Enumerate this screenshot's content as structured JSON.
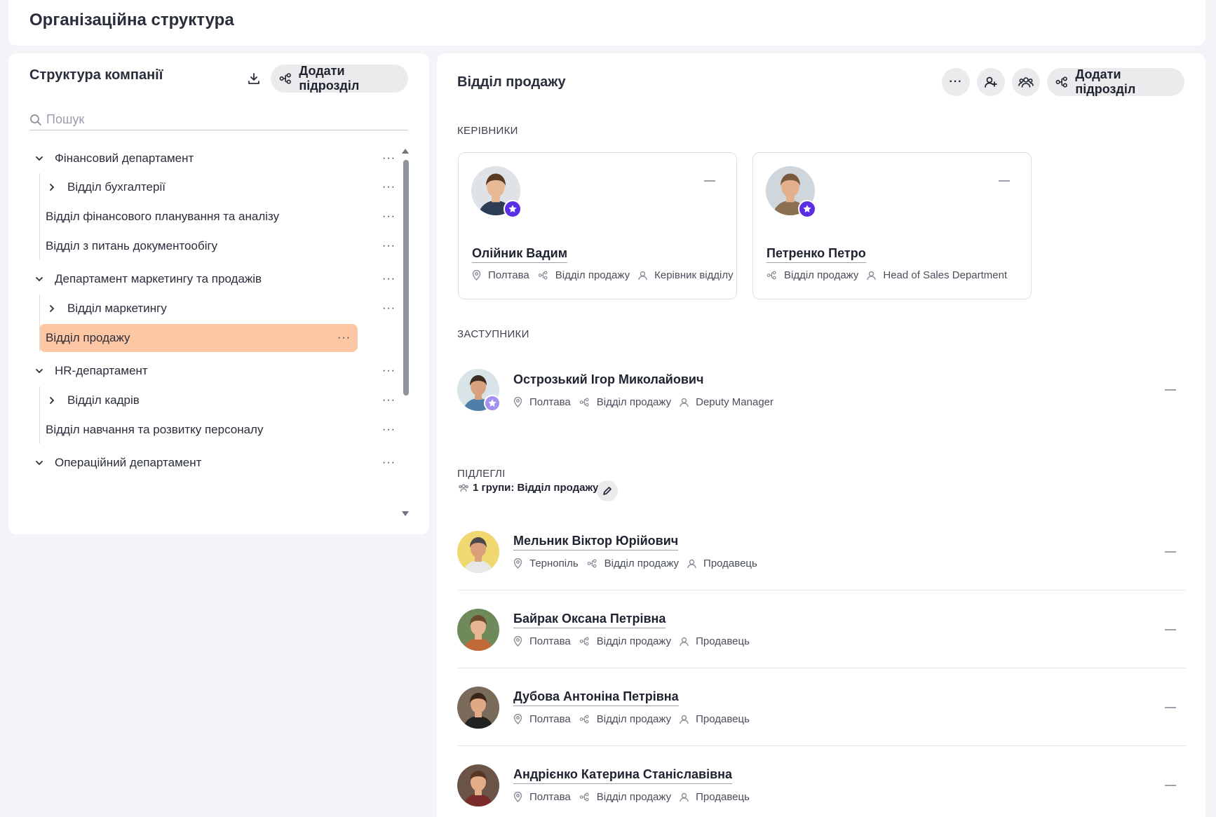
{
  "page": {
    "title": "Організаційна структура"
  },
  "colors": {
    "accent": "#5b2ee6",
    "selected": "#fec7a3",
    "pill": "#ebebee"
  },
  "left": {
    "title": "Структура компанії",
    "download_icon": "download-icon",
    "add_button": "Додати підрозділ",
    "search_placeholder": "Пошук",
    "tree": [
      {
        "label": "Фінансовий департамент",
        "level": 0,
        "chevron": "down"
      },
      {
        "label": "Відділ бухгалтерії",
        "level": 1,
        "chevron": "right"
      },
      {
        "label": "Відділ фінансового планування та аналізу",
        "level": 1,
        "chevron": "none"
      },
      {
        "label": "Відділ з питань документообігу",
        "level": 1,
        "chevron": "none"
      },
      {
        "label": "Департамент маркетингу та продажів",
        "level": 0,
        "chevron": "down"
      },
      {
        "label": "Відділ маркетингу",
        "level": 1,
        "chevron": "right"
      },
      {
        "label": "Відділ продажу",
        "level": 1,
        "chevron": "none",
        "selected": true
      },
      {
        "label": "HR-департамент",
        "level": 0,
        "chevron": "down"
      },
      {
        "label": "Відділ кадрів",
        "level": 1,
        "chevron": "right"
      },
      {
        "label": "Відділ навчання та розвитку персоналу",
        "level": 1,
        "chevron": "none"
      },
      {
        "label": "Операційний департамент",
        "level": 0,
        "chevron": "down"
      }
    ],
    "more": "···"
  },
  "right": {
    "title": "Відділ продажу",
    "more": "···",
    "add_button": "Додати підрозділ",
    "managers_label": "КЕРІВНИКИ",
    "managers": [
      {
        "name": "Олійник Вадим",
        "city": "Полтава",
        "dept": "Відділ продажу",
        "role": "Керівник відділу"
      },
      {
        "name": "Петренко Петро",
        "city": "",
        "dept": "Відділ продажу",
        "role": "Head of Sales Department"
      }
    ],
    "deputies_label": "ЗАСТУПНИКИ",
    "deputies": [
      {
        "name": "Острозький Ігор Миколайович",
        "city": "Полтава",
        "dept": "Відділ продажу",
        "role": "Deputy Manager"
      }
    ],
    "subordinates_label": "ПІДЛЕГЛІ",
    "groups_text": "1 групи: Відділ продажу",
    "subordinates": [
      {
        "name": "Мельник Віктор Юрійович",
        "city": "Тернопіль",
        "dept": "Відділ продажу",
        "role": "Продавець"
      },
      {
        "name": "Байрак Оксана Петрівна",
        "city": "Полтава",
        "dept": "Відділ продажу",
        "role": "Продавець"
      },
      {
        "name": "Дубова Антоніна Петрівна",
        "city": "Полтава",
        "dept": "Відділ продажу",
        "role": "Продавець"
      },
      {
        "name": "Андрієнко Катерина Станіславівна",
        "city": "Полтава",
        "dept": "Відділ продажу",
        "role": "Продавець"
      }
    ]
  }
}
